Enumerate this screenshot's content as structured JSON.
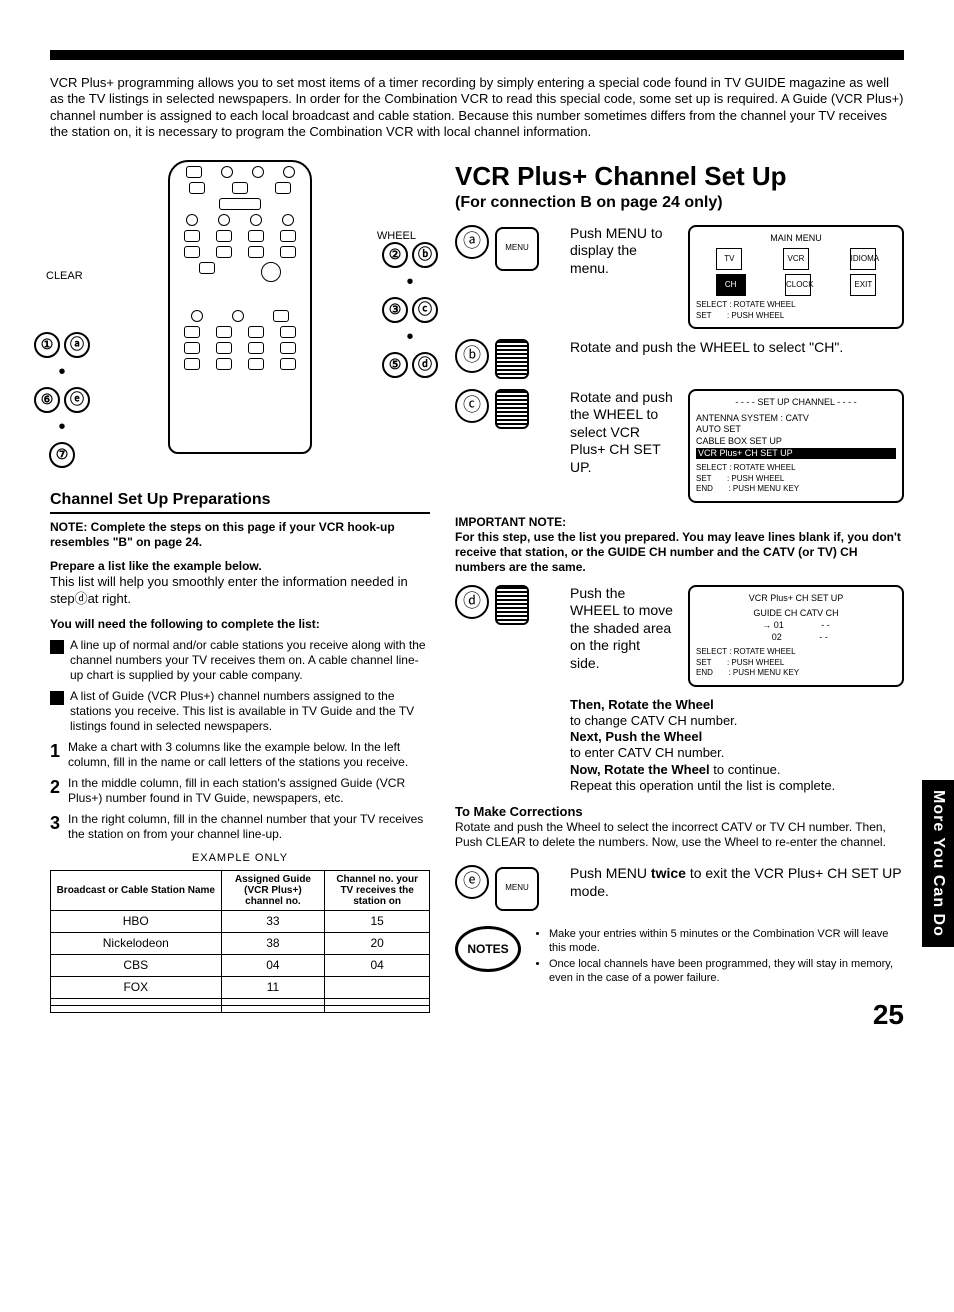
{
  "intro": "VCR Plus+ programming allows you to set most items of a timer recording by simply entering a special code found in TV GUIDE magazine as well as the TV listings in selected newspapers. In order for the Combination VCR to read this special code, some set up is required. A Guide (VCR Plus+) channel number is assigned to each local broadcast and cable station. Because this number sometimes differs from the channel your TV receives the station on, it is necessary to program the Combination VCR with local channel information.",
  "callouts": {
    "clear": "CLEAR",
    "wheel": "WHEEL"
  },
  "circ_left": [
    "①",
    "ⓐ",
    "⑥",
    "ⓔ",
    "⑦"
  ],
  "circ_right": [
    "②",
    "ⓑ",
    "③",
    "ⓒ",
    "⑤",
    "ⓓ"
  ],
  "left": {
    "heading": "Channel Set Up Preparations",
    "note": "NOTE: Complete the steps on this page if your VCR hook-up resembles \"B\" on page 24.",
    "prepare_bold": "Prepare a list like the example below.",
    "prepare_text": "This list will help you smoothly enter the information needed in stepⓓat right.",
    "need": "You will need the following to complete the list:",
    "bullets": [
      "A line up of normal and/or cable stations you receive along with the channel numbers your TV receives them on. A cable channel line-up chart is supplied by your cable company.",
      "A list of Guide (VCR Plus+) channel numbers assigned to the stations you receive. This list is available in TV Guide and the TV listings found in selected newspapers."
    ],
    "nums": [
      "Make a chart with 3 columns like the example below. In the left column, fill in the name or call letters of the stations you receive.",
      "In the middle column, fill in each station's assigned Guide (VCR Plus+) number found in TV Guide, newspapers, etc.",
      "In the right column, fill in the channel number that your TV receives the station on from your channel line-up."
    ],
    "example_title": "EXAMPLE ONLY",
    "table": {
      "h1": "Broadcast or Cable Station Name",
      "h2": "Assigned Guide (VCR Plus+) channel no.",
      "h3": "Channel no. your TV receives the station on",
      "rows": [
        [
          "HBO",
          "33",
          "15"
        ],
        [
          "Nickelodeon",
          "38",
          "20"
        ],
        [
          "CBS",
          "04",
          "04"
        ],
        [
          "FOX",
          "11",
          ""
        ],
        [
          "",
          "",
          ""
        ],
        [
          "",
          "",
          ""
        ]
      ]
    }
  },
  "right": {
    "h1": "VCR Plus+ Channel Set Up",
    "h1sub": "(For connection B on page 24 only)",
    "steps": {
      "a": {
        "letter": "ⓐ",
        "icon": "MENU",
        "text": "Push MENU to display the menu."
      },
      "b": {
        "letter": "ⓑ",
        "text": "Rotate and push the WHEEL to select \"CH\"."
      },
      "c": {
        "letter": "ⓒ",
        "text": "Rotate and push the WHEEL to select VCR Plus+ CH SET UP."
      },
      "d": {
        "letter": "ⓓ",
        "text": "Push the WHEEL to move the shaded area on the right side."
      },
      "e": {
        "letter": "ⓔ",
        "icon": "MENU",
        "text": "Push MENU twice to exit the VCR Plus+ CH SET UP mode."
      }
    },
    "osd_main": {
      "title": "MAIN MENU",
      "cells": [
        "TV",
        "VCR",
        "IDIOMA",
        "CH",
        "CLOCK",
        "EXIT"
      ],
      "foot": "SELECT : ROTATE WHEEL\nSET       : PUSH WHEEL"
    },
    "osd_setup": {
      "title": "- - - -  SET UP CHANNEL  - - - -",
      "lines": [
        "ANTENNA SYSTEM   : CATV",
        "AUTO SET",
        "CABLE BOX SET UP"
      ],
      "inverse": "VCR Plus+ CH SET UP",
      "foot": "SELECT : ROTATE WHEEL\nSET       : PUSH WHEEL\nEND       : PUSH MENU KEY"
    },
    "osd_vcrp": {
      "title": "VCR Plus+ CH SET UP",
      "header": "GUIDE CH     CATV CH",
      "rows": [
        "→ 01               - -",
        "   02               - -"
      ],
      "foot": "SELECT : ROTATE WHEEL\nSET       : PUSH WHEEL\nEND       : PUSH MENU KEY"
    },
    "imp_head": "IMPORTANT NOTE:",
    "imp_text": "For this step, use the list you prepared. You may leave lines blank if, you don't receive that station, or the GUIDE CH number and the CATV (or TV) CH numbers are the same.",
    "then": {
      "t1": "Then, Rotate the Wheel",
      "d1": "to change CATV CH number.",
      "t2": "Next, Push the Wheel",
      "d2": "to enter CATV CH number.",
      "t3": "Now, Rotate the Wheel",
      "d3": " to continue.",
      "d4": "Repeat this operation until the list is complete."
    },
    "corr_head": "To Make Corrections",
    "corr_text": "Rotate and push the Wheel to select the incorrect CATV or TV CH number. Then, Push CLEAR to delete the numbers. Now, use the Wheel to re-enter the channel.",
    "notes_label": "NOTES",
    "notes": [
      "Make your entries within 5 minutes or the Combination VCR will leave this mode.",
      "Once local channels have been programmed, they will stay in memory, even in the case of a power failure."
    ]
  },
  "side_tab": "More You Can Do",
  "pagenum": "25"
}
